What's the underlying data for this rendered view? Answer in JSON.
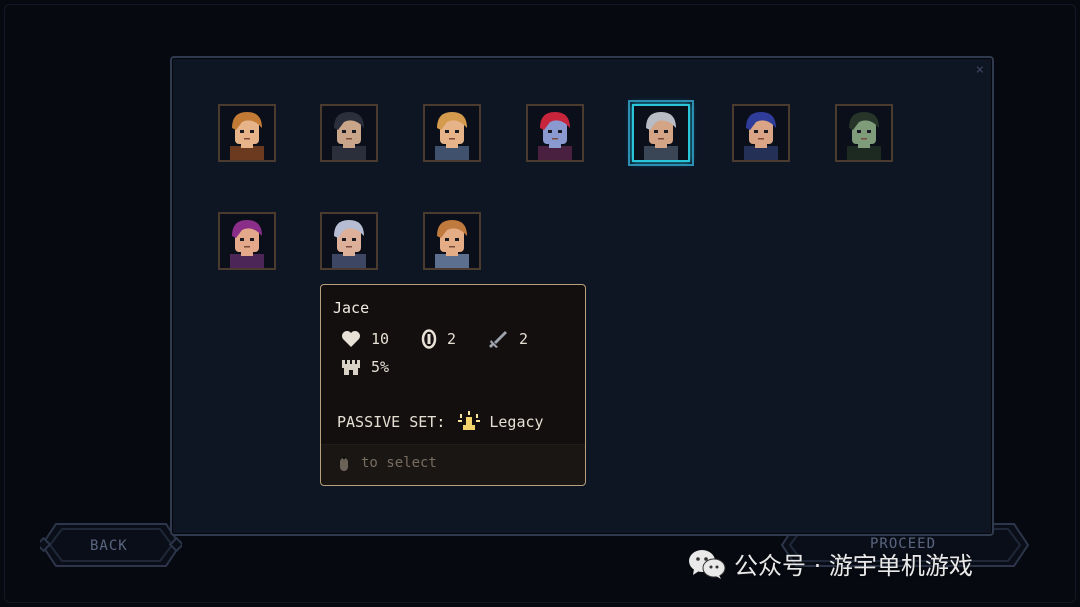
{
  "buttons": {
    "back_label": "BACK",
    "proceed_label": "PROCEED"
  },
  "panel": {
    "close_glyph": "×"
  },
  "characters": [
    {
      "id": "char-1",
      "hair": "#c27a35",
      "skin": "#e7b48a",
      "shirt": "#6b3a1f"
    },
    {
      "id": "char-2",
      "hair": "#2b2f3b",
      "skin": "#c9a58a",
      "shirt": "#2b2f3b"
    },
    {
      "id": "char-3",
      "hair": "#d49a4e",
      "skin": "#e7b48a",
      "shirt": "#40516e"
    },
    {
      "id": "char-4",
      "hair": "#c8243c",
      "skin": "#8a9ad0",
      "shirt": "#4a2040"
    },
    {
      "id": "char-5",
      "hair": "#b9bcc4",
      "skin": "#d4a487",
      "shirt": "#3a4556"
    },
    {
      "id": "char-6",
      "hair": "#2f3c9a",
      "skin": "#d9a586",
      "shirt": "#253056"
    },
    {
      "id": "char-7",
      "hair": "#27342a",
      "skin": "#7f9c7a",
      "shirt": "#1d2a22"
    },
    {
      "id": "char-8",
      "hair": "#8a2e8a",
      "skin": "#e3a98a",
      "shirt": "#4b2657"
    },
    {
      "id": "char-9",
      "hair": "#b6bcd2",
      "skin": "#dcb099",
      "shirt": "#3d4763"
    },
    {
      "id": "char-10",
      "hair": "#c07a3e",
      "skin": "#e4ad85",
      "shirt": "#5c6f8f"
    }
  ],
  "selected_index": 4,
  "tooltip": {
    "name": "Jace",
    "stats": {
      "health": "10",
      "armor": "2",
      "attack": "2",
      "crit": "5%"
    },
    "passive_label": "PASSIVE SET:",
    "passive_set": "Legacy",
    "hint": "to select"
  },
  "icons": {
    "health": "heart-icon",
    "armor": "shield-icon",
    "attack": "sword-icon",
    "crit": "castle-icon",
    "passive": "legacy-icon",
    "mouse": "mouse-icon"
  },
  "colors": {
    "panel_bg": "#0e1624",
    "selected_border": "#29c6d9",
    "tooltip_border": "#b7a17d",
    "passive_icon": "#f2d46b"
  },
  "watermark": {
    "text": "公众号 · 游宇单机游戏"
  }
}
